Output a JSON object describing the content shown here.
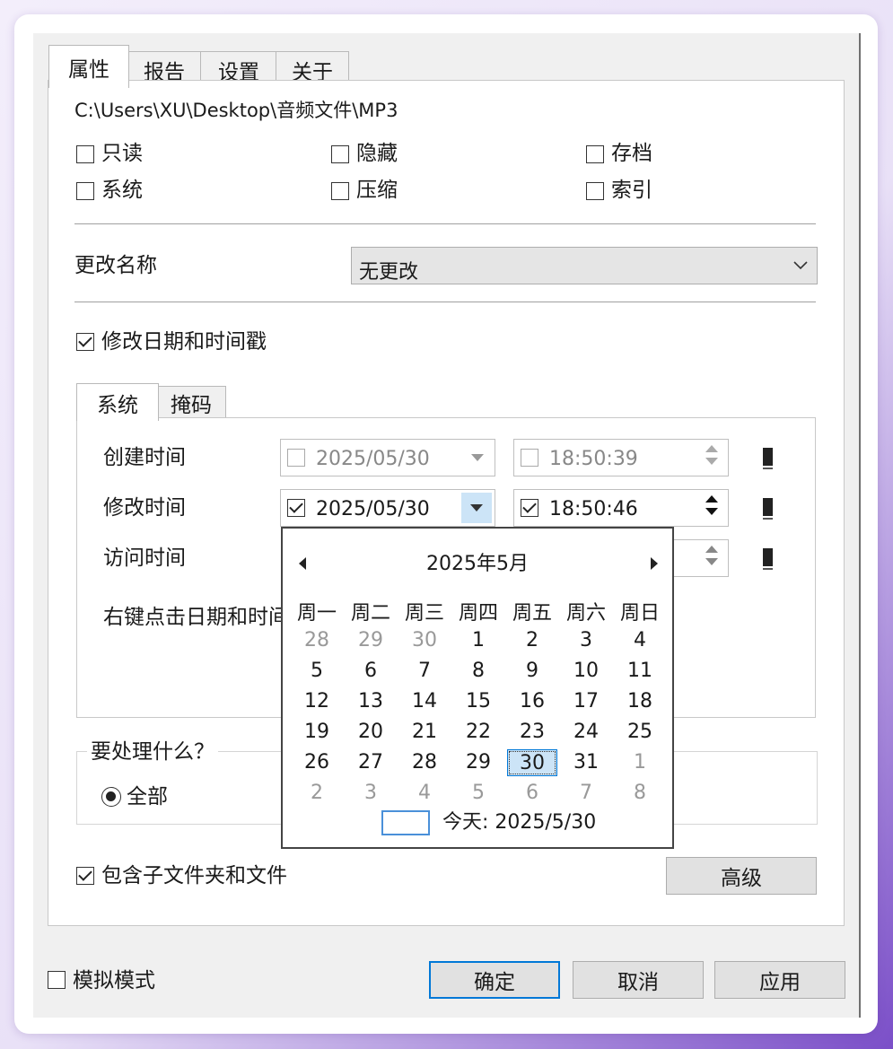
{
  "tabs": [
    "属性",
    "报告",
    "设置",
    "关于"
  ],
  "path": "C:\\Users\\XU\\Desktop\\音频文件\\MP3",
  "attributes": {
    "readonly": {
      "label": "只读",
      "checked": false
    },
    "hidden": {
      "label": "隐藏",
      "checked": false
    },
    "archive": {
      "label": "存档",
      "checked": false
    },
    "system": {
      "label": "系统",
      "checked": false
    },
    "compress": {
      "label": "压缩",
      "checked": false
    },
    "index": {
      "label": "索引",
      "checked": false
    }
  },
  "rename": {
    "label": "更改名称",
    "value": "无更改"
  },
  "modify_datetime": {
    "label": "修改日期和时间戳",
    "checked": true
  },
  "subtabs": [
    "系统",
    "掩码"
  ],
  "rows": {
    "created": {
      "label": "创建时间",
      "date": "2025/05/30",
      "time": "18:50:39",
      "checked": false
    },
    "modified": {
      "label": "修改时间",
      "date": "2025/05/30",
      "time": "18:50:46",
      "checked": true
    },
    "accessed": {
      "label": "访问时间"
    }
  },
  "hint": "右键点击日期和时间",
  "process": {
    "title": "要处理什么？",
    "option": "全部"
  },
  "include_subfolders": {
    "label": "包含子文件夹和文件",
    "checked": true
  },
  "advanced_button": "高级",
  "simulate": {
    "label": "模拟模式",
    "checked": false
  },
  "buttons": {
    "ok": "确定",
    "cancel": "取消",
    "apply": "应用"
  },
  "calendar": {
    "title": "2025年5月",
    "weekdays": [
      "周一",
      "周二",
      "周三",
      "周四",
      "周五",
      "周六",
      "周日"
    ],
    "weeks": [
      [
        "28",
        "29",
        "30",
        "1",
        "2",
        "3",
        "4"
      ],
      [
        "5",
        "6",
        "7",
        "8",
        "9",
        "10",
        "11"
      ],
      [
        "12",
        "13",
        "14",
        "15",
        "16",
        "17",
        "18"
      ],
      [
        "19",
        "20",
        "21",
        "22",
        "23",
        "24",
        "25"
      ],
      [
        "26",
        "27",
        "28",
        "29",
        "30",
        "31",
        "1"
      ],
      [
        "2",
        "3",
        "4",
        "5",
        "6",
        "7",
        "8"
      ]
    ],
    "muted": [
      [
        0,
        0
      ],
      [
        0,
        1
      ],
      [
        0,
        2
      ],
      [
        4,
        6
      ],
      [
        5,
        0
      ],
      [
        5,
        1
      ],
      [
        5,
        2
      ],
      [
        5,
        3
      ],
      [
        5,
        4
      ],
      [
        5,
        5
      ],
      [
        5,
        6
      ]
    ],
    "selected": "30",
    "today_label": "今天: 2025/5/30"
  },
  "colors": {
    "accent": "#0078d7",
    "selected_bg": "#cce4f7"
  }
}
